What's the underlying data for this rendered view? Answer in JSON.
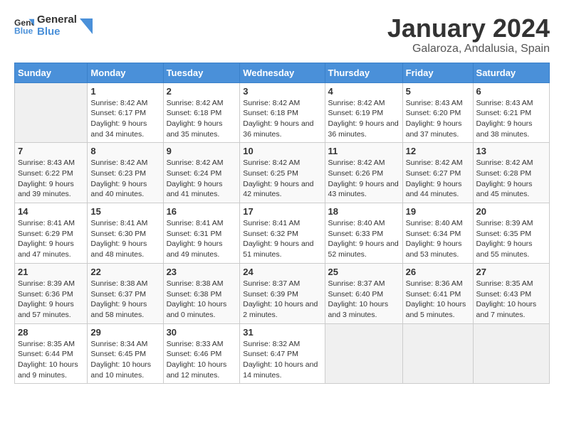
{
  "logo": {
    "general": "General",
    "blue": "Blue"
  },
  "title": "January 2024",
  "subtitle": "Galaroza, Andalusia, Spain",
  "days_header": [
    "Sunday",
    "Monday",
    "Tuesday",
    "Wednesday",
    "Thursday",
    "Friday",
    "Saturday"
  ],
  "weeks": [
    [
      {
        "day": "",
        "sunrise": "",
        "sunset": "",
        "daylight": ""
      },
      {
        "day": "1",
        "sunrise": "Sunrise: 8:42 AM",
        "sunset": "Sunset: 6:17 PM",
        "daylight": "Daylight: 9 hours and 34 minutes."
      },
      {
        "day": "2",
        "sunrise": "Sunrise: 8:42 AM",
        "sunset": "Sunset: 6:18 PM",
        "daylight": "Daylight: 9 hours and 35 minutes."
      },
      {
        "day": "3",
        "sunrise": "Sunrise: 8:42 AM",
        "sunset": "Sunset: 6:18 PM",
        "daylight": "Daylight: 9 hours and 36 minutes."
      },
      {
        "day": "4",
        "sunrise": "Sunrise: 8:42 AM",
        "sunset": "Sunset: 6:19 PM",
        "daylight": "Daylight: 9 hours and 36 minutes."
      },
      {
        "day": "5",
        "sunrise": "Sunrise: 8:43 AM",
        "sunset": "Sunset: 6:20 PM",
        "daylight": "Daylight: 9 hours and 37 minutes."
      },
      {
        "day": "6",
        "sunrise": "Sunrise: 8:43 AM",
        "sunset": "Sunset: 6:21 PM",
        "daylight": "Daylight: 9 hours and 38 minutes."
      }
    ],
    [
      {
        "day": "7",
        "sunrise": "Sunrise: 8:43 AM",
        "sunset": "Sunset: 6:22 PM",
        "daylight": "Daylight: 9 hours and 39 minutes."
      },
      {
        "day": "8",
        "sunrise": "Sunrise: 8:42 AM",
        "sunset": "Sunset: 6:23 PM",
        "daylight": "Daylight: 9 hours and 40 minutes."
      },
      {
        "day": "9",
        "sunrise": "Sunrise: 8:42 AM",
        "sunset": "Sunset: 6:24 PM",
        "daylight": "Daylight: 9 hours and 41 minutes."
      },
      {
        "day": "10",
        "sunrise": "Sunrise: 8:42 AM",
        "sunset": "Sunset: 6:25 PM",
        "daylight": "Daylight: 9 hours and 42 minutes."
      },
      {
        "day": "11",
        "sunrise": "Sunrise: 8:42 AM",
        "sunset": "Sunset: 6:26 PM",
        "daylight": "Daylight: 9 hours and 43 minutes."
      },
      {
        "day": "12",
        "sunrise": "Sunrise: 8:42 AM",
        "sunset": "Sunset: 6:27 PM",
        "daylight": "Daylight: 9 hours and 44 minutes."
      },
      {
        "day": "13",
        "sunrise": "Sunrise: 8:42 AM",
        "sunset": "Sunset: 6:28 PM",
        "daylight": "Daylight: 9 hours and 45 minutes."
      }
    ],
    [
      {
        "day": "14",
        "sunrise": "Sunrise: 8:41 AM",
        "sunset": "Sunset: 6:29 PM",
        "daylight": "Daylight: 9 hours and 47 minutes."
      },
      {
        "day": "15",
        "sunrise": "Sunrise: 8:41 AM",
        "sunset": "Sunset: 6:30 PM",
        "daylight": "Daylight: 9 hours and 48 minutes."
      },
      {
        "day": "16",
        "sunrise": "Sunrise: 8:41 AM",
        "sunset": "Sunset: 6:31 PM",
        "daylight": "Daylight: 9 hours and 49 minutes."
      },
      {
        "day": "17",
        "sunrise": "Sunrise: 8:41 AM",
        "sunset": "Sunset: 6:32 PM",
        "daylight": "Daylight: 9 hours and 51 minutes."
      },
      {
        "day": "18",
        "sunrise": "Sunrise: 8:40 AM",
        "sunset": "Sunset: 6:33 PM",
        "daylight": "Daylight: 9 hours and 52 minutes."
      },
      {
        "day": "19",
        "sunrise": "Sunrise: 8:40 AM",
        "sunset": "Sunset: 6:34 PM",
        "daylight": "Daylight: 9 hours and 53 minutes."
      },
      {
        "day": "20",
        "sunrise": "Sunrise: 8:39 AM",
        "sunset": "Sunset: 6:35 PM",
        "daylight": "Daylight: 9 hours and 55 minutes."
      }
    ],
    [
      {
        "day": "21",
        "sunrise": "Sunrise: 8:39 AM",
        "sunset": "Sunset: 6:36 PM",
        "daylight": "Daylight: 9 hours and 57 minutes."
      },
      {
        "day": "22",
        "sunrise": "Sunrise: 8:38 AM",
        "sunset": "Sunset: 6:37 PM",
        "daylight": "Daylight: 9 hours and 58 minutes."
      },
      {
        "day": "23",
        "sunrise": "Sunrise: 8:38 AM",
        "sunset": "Sunset: 6:38 PM",
        "daylight": "Daylight: 10 hours and 0 minutes."
      },
      {
        "day": "24",
        "sunrise": "Sunrise: 8:37 AM",
        "sunset": "Sunset: 6:39 PM",
        "daylight": "Daylight: 10 hours and 2 minutes."
      },
      {
        "day": "25",
        "sunrise": "Sunrise: 8:37 AM",
        "sunset": "Sunset: 6:40 PM",
        "daylight": "Daylight: 10 hours and 3 minutes."
      },
      {
        "day": "26",
        "sunrise": "Sunrise: 8:36 AM",
        "sunset": "Sunset: 6:41 PM",
        "daylight": "Daylight: 10 hours and 5 minutes."
      },
      {
        "day": "27",
        "sunrise": "Sunrise: 8:35 AM",
        "sunset": "Sunset: 6:43 PM",
        "daylight": "Daylight: 10 hours and 7 minutes."
      }
    ],
    [
      {
        "day": "28",
        "sunrise": "Sunrise: 8:35 AM",
        "sunset": "Sunset: 6:44 PM",
        "daylight": "Daylight: 10 hours and 9 minutes."
      },
      {
        "day": "29",
        "sunrise": "Sunrise: 8:34 AM",
        "sunset": "Sunset: 6:45 PM",
        "daylight": "Daylight: 10 hours and 10 minutes."
      },
      {
        "day": "30",
        "sunrise": "Sunrise: 8:33 AM",
        "sunset": "Sunset: 6:46 PM",
        "daylight": "Daylight: 10 hours and 12 minutes."
      },
      {
        "day": "31",
        "sunrise": "Sunrise: 8:32 AM",
        "sunset": "Sunset: 6:47 PM",
        "daylight": "Daylight: 10 hours and 14 minutes."
      },
      {
        "day": "",
        "sunrise": "",
        "sunset": "",
        "daylight": ""
      },
      {
        "day": "",
        "sunrise": "",
        "sunset": "",
        "daylight": ""
      },
      {
        "day": "",
        "sunrise": "",
        "sunset": "",
        "daylight": ""
      }
    ]
  ]
}
